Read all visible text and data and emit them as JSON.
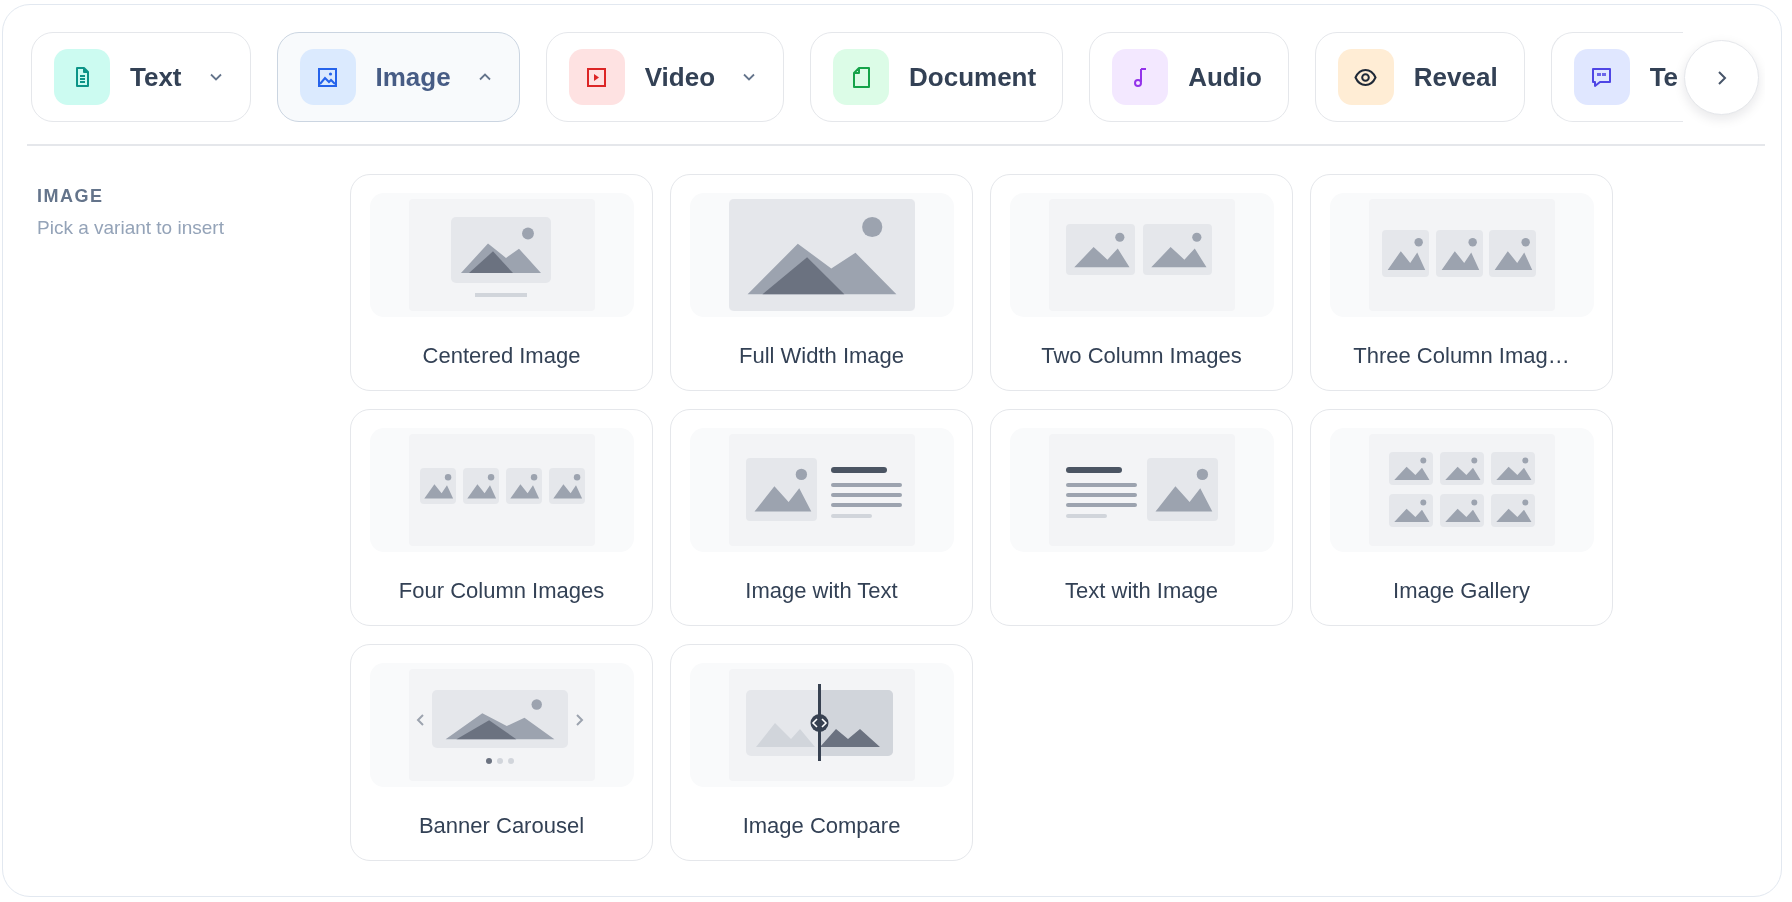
{
  "tabs": [
    {
      "label": "Text",
      "kind": "dropdown",
      "expanded": false,
      "selected": false,
      "color": "#0d9488"
    },
    {
      "label": "Image",
      "kind": "dropdown",
      "expanded": true,
      "selected": true,
      "color": "#2563eb"
    },
    {
      "label": "Video",
      "kind": "dropdown",
      "expanded": false,
      "selected": false,
      "color": "#dc2626"
    },
    {
      "label": "Document",
      "kind": "plain",
      "selected": false,
      "color": "#16a34a"
    },
    {
      "label": "Audio",
      "kind": "plain",
      "selected": false,
      "color": "#9333ea"
    },
    {
      "label": "Reveal",
      "kind": "plain",
      "selected": false,
      "color": "#1f2937"
    },
    {
      "label": "Te",
      "kind": "plain",
      "selected": false,
      "color": "#4f46e5"
    }
  ],
  "section": {
    "title": "IMAGE",
    "subtitle": "Pick a variant to insert"
  },
  "variants": [
    {
      "label": "Centered Image",
      "kind": "centered"
    },
    {
      "label": "Full Width Image",
      "kind": "full"
    },
    {
      "label": "Two Column Images",
      "kind": "two"
    },
    {
      "label": "Three Column Imag…",
      "kind": "three"
    },
    {
      "label": "Four Column Images",
      "kind": "four"
    },
    {
      "label": "Image with Text",
      "kind": "image_text"
    },
    {
      "label": "Text with Image",
      "kind": "text_image"
    },
    {
      "label": "Image Gallery",
      "kind": "gallery"
    },
    {
      "label": "Banner Carousel",
      "kind": "carousel"
    },
    {
      "label": "Image Compare",
      "kind": "compare"
    }
  ]
}
